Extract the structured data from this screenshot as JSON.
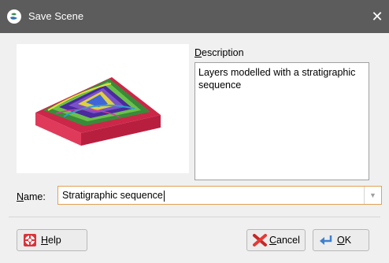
{
  "window": {
    "title": "Save Scene",
    "close_glyph": "✕"
  },
  "preview": {
    "icon": "3d-model-thumbnail"
  },
  "description": {
    "label_accel": "D",
    "label_rest": "escription",
    "text": "Layers modelled with a stratigraphic sequence"
  },
  "name": {
    "label_accel": "N",
    "label_rest": "ame:",
    "value": "Stratigraphic sequence",
    "dropdown_glyph": "▼"
  },
  "buttons": {
    "help": {
      "accel": "H",
      "rest": "elp",
      "icon": "lifebuoy-icon"
    },
    "cancel": {
      "accel": "C",
      "rest": "ancel",
      "icon": "red-x-icon"
    },
    "ok": {
      "accel": "O",
      "rest": "K",
      "icon": "ok-arrow-icon"
    }
  },
  "colors": {
    "titlebar": "#5c5c5c",
    "focus_border": "#e3a157",
    "model_top": "#4a2a9e",
    "model_side": "#cc2748"
  }
}
